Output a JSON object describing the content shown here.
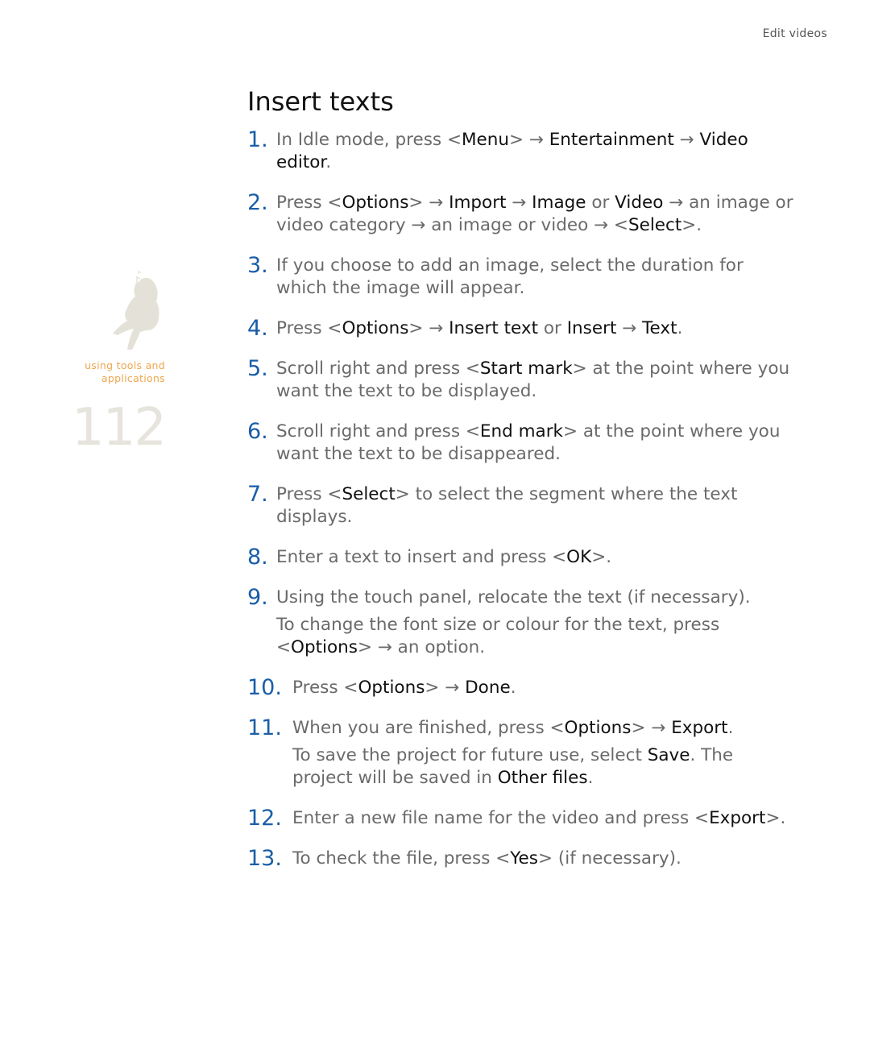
{
  "header": {
    "section": "Edit videos"
  },
  "sidebar": {
    "figure_icon": "person-with-headphones-silhouette",
    "label_line1": "using tools and",
    "label_line2": "applications",
    "page_number": "112"
  },
  "title": "Insert texts",
  "steps": [
    {
      "num": "1.",
      "segments": [
        {
          "t": "In Idle mode, press <"
        },
        {
          "t": "Menu",
          "h": true
        },
        {
          "t": "> → "
        },
        {
          "t": "Entertainment",
          "h": true
        },
        {
          "t": " → "
        },
        {
          "t": "Video editor",
          "h": true
        },
        {
          "t": "."
        }
      ]
    },
    {
      "num": "2.",
      "segments": [
        {
          "t": "Press <"
        },
        {
          "t": "Options",
          "h": true
        },
        {
          "t": "> → "
        },
        {
          "t": "Import",
          "h": true
        },
        {
          "t": " → "
        },
        {
          "t": "Image",
          "h": true
        },
        {
          "t": " or "
        },
        {
          "t": "Video",
          "h": true
        },
        {
          "t": " → an image or video category → an image or video → <"
        },
        {
          "t": "Select",
          "h": true
        },
        {
          "t": ">."
        }
      ]
    },
    {
      "num": "3.",
      "segments": [
        {
          "t": "If you choose to add an image, select the duration for which the image will appear."
        }
      ]
    },
    {
      "num": "4.",
      "segments": [
        {
          "t": "Press <"
        },
        {
          "t": "Options",
          "h": true
        },
        {
          "t": "> → "
        },
        {
          "t": "Insert text",
          "h": true
        },
        {
          "t": " or "
        },
        {
          "t": "Insert",
          "h": true
        },
        {
          "t": " → "
        },
        {
          "t": "Text",
          "h": true
        },
        {
          "t": "."
        }
      ]
    },
    {
      "num": "5.",
      "segments": [
        {
          "t": "Scroll right and press <"
        },
        {
          "t": "Start mark",
          "h": true
        },
        {
          "t": "> at the point where you want the text to be displayed."
        }
      ]
    },
    {
      "num": "6.",
      "segments": [
        {
          "t": "Scroll right and press <"
        },
        {
          "t": "End mark",
          "h": true
        },
        {
          "t": "> at the point where you want the text to be disappeared."
        }
      ]
    },
    {
      "num": "7.",
      "segments": [
        {
          "t": "Press <"
        },
        {
          "t": "Select",
          "h": true
        },
        {
          "t": "> to select the segment where the text displays."
        }
      ]
    },
    {
      "num": "8.",
      "segments": [
        {
          "t": "Enter a text to insert and press <"
        },
        {
          "t": "OK",
          "h": true
        },
        {
          "t": ">."
        }
      ]
    },
    {
      "num": "9.",
      "segments": [
        {
          "t": "Using the touch panel, relocate the text (if necessary)."
        }
      ],
      "note": [
        {
          "t": "To change the font size or colour for the text, press <"
        },
        {
          "t": "Options",
          "h": true
        },
        {
          "t": "> → an option."
        }
      ]
    },
    {
      "num": "10.",
      "segments": [
        {
          "t": "Press <"
        },
        {
          "t": "Options",
          "h": true
        },
        {
          "t": "> → "
        },
        {
          "t": "Done",
          "h": true
        },
        {
          "t": "."
        }
      ]
    },
    {
      "num": "11.",
      "segments": [
        {
          "t": "When you are finished, press <"
        },
        {
          "t": "Options",
          "h": true
        },
        {
          "t": "> → "
        },
        {
          "t": "Export",
          "h": true
        },
        {
          "t": "."
        }
      ],
      "note": [
        {
          "t": "To save the project for future use, select "
        },
        {
          "t": "Save",
          "h": true
        },
        {
          "t": ". The project will be saved in "
        },
        {
          "t": "Other files",
          "h": true
        },
        {
          "t": "."
        }
      ]
    },
    {
      "num": "12.",
      "segments": [
        {
          "t": "Enter a new file name for the video and press <"
        },
        {
          "t": "Export",
          "h": true
        },
        {
          "t": ">."
        }
      ]
    },
    {
      "num": "13.",
      "segments": [
        {
          "t": "To check the file, press <"
        },
        {
          "t": "Yes",
          "h": true
        },
        {
          "t": "> (if necessary)."
        }
      ]
    }
  ],
  "colors": {
    "step_number": "#1a5ea8",
    "body_text": "#6a6a6a",
    "highlight_text": "#111111",
    "section_label": "#f0a64e",
    "page_number": "#e6e4dc"
  }
}
